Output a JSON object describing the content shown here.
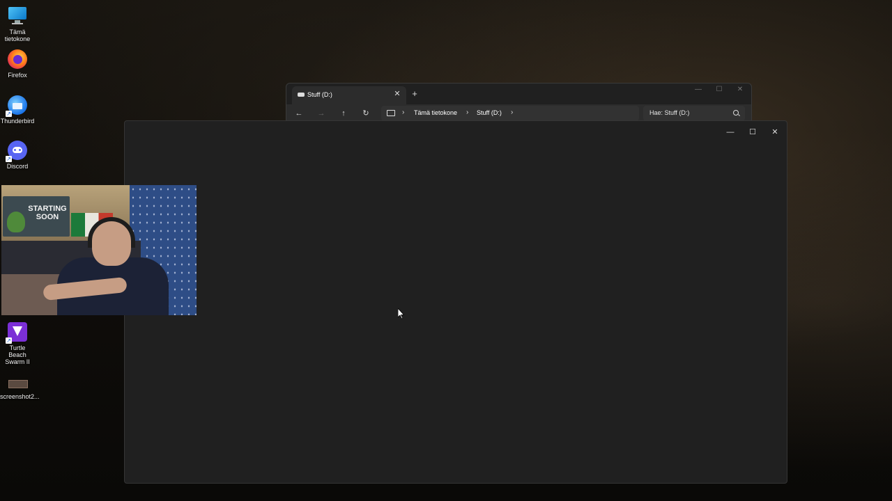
{
  "desktop": {
    "icons": [
      {
        "label_line1": "Tämä",
        "label_line2": "tietokone",
        "icon": "computer-icon"
      },
      {
        "label_line1": "Firefox",
        "label_line2": "",
        "icon": "firefox-icon"
      },
      {
        "label_line1": "Thunderbird",
        "label_line2": "",
        "icon": "thunderbird-icon"
      },
      {
        "label_line1": "Discord",
        "label_line2": "",
        "icon": "discord-icon"
      },
      {
        "label_line1": "Turtle Beach",
        "label_line2": "Swarm II",
        "icon": "turtle-beach-icon"
      },
      {
        "label_line1": "screenshot2...",
        "label_line2": "",
        "icon": "image-file-icon"
      }
    ]
  },
  "explorer": {
    "tab_title": "Stuff (D:)",
    "tab_close": "✕",
    "new_tab": "+",
    "minimize": "—",
    "maximize": "☐",
    "close": "✕",
    "nav": {
      "back": "←",
      "forward": "→",
      "up": "↑",
      "refresh": "↻"
    },
    "breadcrumb": [
      "Tämä tietokone",
      "Stuff (D:)"
    ],
    "separator": "›",
    "search_placeholder": "Hae: Stuff (D:)"
  },
  "blank_window": {
    "minimize": "—",
    "maximize": "☐",
    "close": "✕"
  },
  "webcam": {
    "poster_text": "STARTING SOON"
  },
  "colors": {
    "window_bg": "#202020",
    "toolbar_bg": "#2c2c2c",
    "accent_curtain": "#2e4d86"
  }
}
